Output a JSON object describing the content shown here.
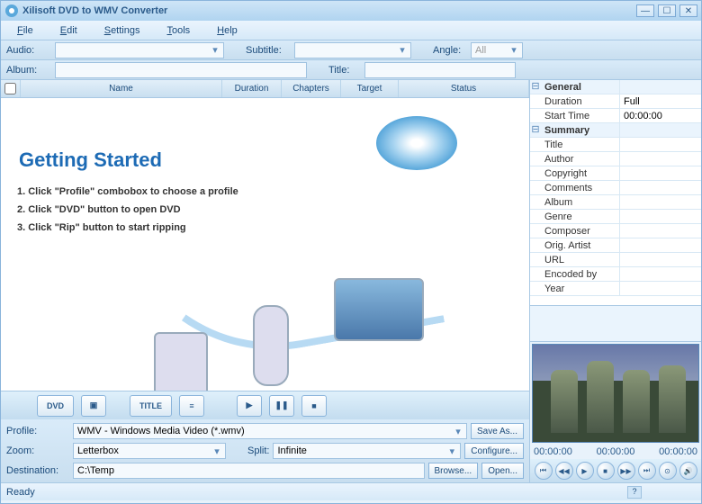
{
  "title": "Xilisoft DVD to WMV Converter",
  "menu": {
    "file": "File",
    "edit": "Edit",
    "settings": "Settings",
    "tools": "Tools",
    "help": "Help"
  },
  "toprow1": {
    "audio_lbl": "Audio:",
    "audio_val": "",
    "subtitle_lbl": "Subtitle:",
    "subtitle_val": "",
    "angle_lbl": "Angle:",
    "angle_val": "All"
  },
  "toprow2": {
    "album_lbl": "Album:",
    "album_val": "",
    "title_lbl": "Title:",
    "title_val": ""
  },
  "grid_cols": {
    "name": "Name",
    "duration": "Duration",
    "chapters": "Chapters",
    "target": "Target",
    "status": "Status"
  },
  "getting_started": {
    "heading": "Getting Started",
    "step1": "1. Click \"Profile\" combobox to choose a profile",
    "step2": "2. Click \"DVD\" button to open DVD",
    "step3": "3. Click \"Rip\" button to start ripping"
  },
  "btnbar": {
    "dvd": "DVD",
    "title": "TITLE"
  },
  "opts": {
    "profile_lbl": "Profile:",
    "profile_val": "WMV - Windows Media Video  (*.wmv)",
    "save_as": "Save As...",
    "zoom_lbl": "Zoom:",
    "zoom_val": "Letterbox",
    "split_lbl": "Split:",
    "split_val": "Infinite",
    "configure": "Configure...",
    "dest_lbl": "Destination:",
    "dest_val": "C:\\Temp",
    "browse": "Browse...",
    "open": "Open..."
  },
  "props": {
    "general": "General",
    "duration_k": "Duration",
    "duration_v": "Full",
    "start_k": "Start Time",
    "start_v": "00:00:00",
    "summary": "Summary",
    "title_k": "Title",
    "author_k": "Author",
    "copyright_k": "Copyright",
    "comments_k": "Comments",
    "album_k": "Album",
    "genre_k": "Genre",
    "composer_k": "Composer",
    "origartist_k": "Orig. Artist",
    "url_k": "URL",
    "encodedby_k": "Encoded by",
    "year_k": "Year"
  },
  "timeline": {
    "t0": "00:00:00",
    "t1": "00:00:00",
    "t2": "00:00:00"
  },
  "status": "Ready"
}
